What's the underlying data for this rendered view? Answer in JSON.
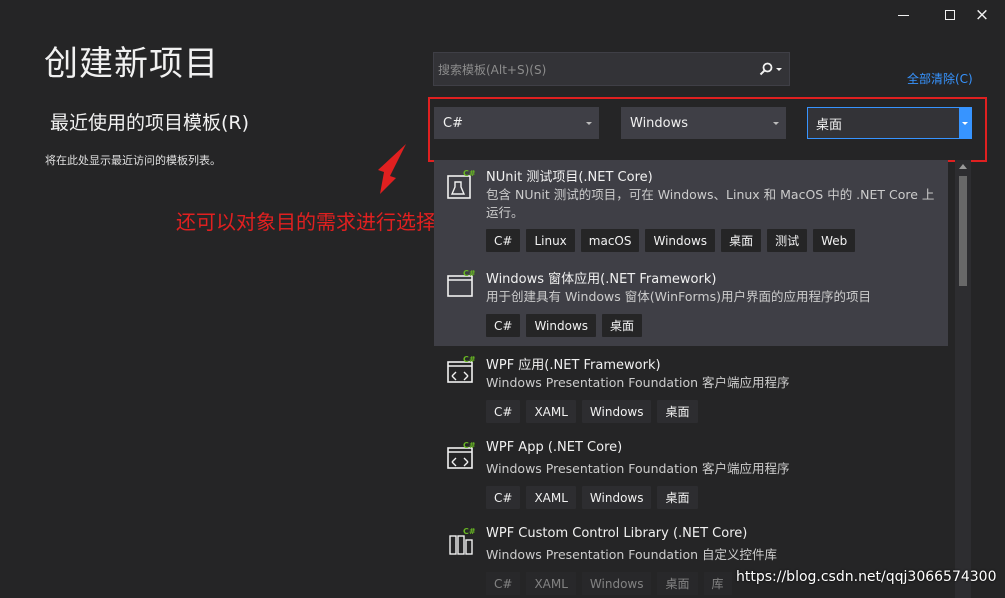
{
  "window": {
    "controls": {
      "minimize": "minimize",
      "maximize": "maximize",
      "close": "×"
    }
  },
  "header": {
    "title": "创建新项目"
  },
  "recent": {
    "title": "最近使用的项目模板(R)",
    "description": "将在此处显示最近访问的模板列表。"
  },
  "search": {
    "placeholder": "搜索模板(Alt+S)(S)"
  },
  "clear_all": "全部清除(C)",
  "filters": {
    "language": "C#",
    "platform": "Windows",
    "project_type": "桌面"
  },
  "annotation": {
    "text": "还可以对象目的需求进行选择",
    "color": "#e02020"
  },
  "templates": [
    {
      "title": "NUnit 测试项目(.NET Core)",
      "description": "包含 NUnit 测试的项目，可在 Windows、Linux 和 MacOS 中的 .NET Core 上运行。",
      "tags": [
        "C#",
        "Linux",
        "macOS",
        "Windows",
        "桌面",
        "测试",
        "Web"
      ],
      "icon": "nunit-test-project-icon"
    },
    {
      "title": "Windows 窗体应用(.NET Framework)",
      "description": "用于创建具有 Windows 窗体(WinForms)用户界面的应用程序的项目",
      "tags": [
        "C#",
        "Windows",
        "桌面"
      ],
      "icon": "winforms-app-icon"
    },
    {
      "title": "WPF 应用(.NET Framework)",
      "description": "Windows Presentation Foundation 客户端应用程序",
      "tags": [
        "C#",
        "XAML",
        "Windows",
        "桌面"
      ],
      "icon": "wpf-app-icon"
    },
    {
      "title": "WPF App (.NET Core)",
      "description": "Windows Presentation Foundation 客户端应用程序",
      "tags": [
        "C#",
        "XAML",
        "Windows",
        "桌面"
      ],
      "icon": "wpf-app-icon"
    },
    {
      "title": "WPF Custom Control Library (.NET Core)",
      "description": "Windows Presentation Foundation 自定义控件库",
      "tags": [
        "C#",
        "XAML",
        "Windows",
        "桌面",
        "库"
      ],
      "icon": "wpf-control-library-icon"
    }
  ],
  "watermark": "https://blog.csdn.net/qqj3066574300",
  "colors": {
    "background": "#252526",
    "accent": "#3794ff",
    "highlight_row": "#3f3f46",
    "annotation": "#e02020"
  }
}
